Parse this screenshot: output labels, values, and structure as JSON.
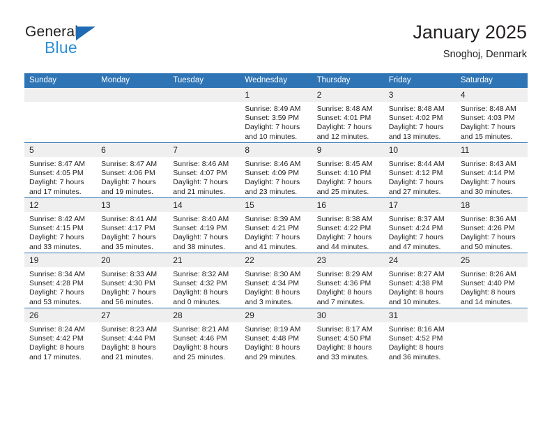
{
  "brand": {
    "name_top": "General",
    "name_bottom": "Blue",
    "triangle_color": "#1f6cb4",
    "blue_color": "#2d8fd5"
  },
  "header": {
    "title": "January 2025",
    "subtitle": "Snoghoj, Denmark"
  },
  "theme": {
    "header_bg": "#2f75b5",
    "header_text": "#ffffff",
    "daynum_bg": "#efefef",
    "grid_line": "#2f75b5",
    "text": "#231f20"
  },
  "labels": {
    "sunrise": "Sunrise:",
    "sunset": "Sunset:",
    "daylight": "Daylight:"
  },
  "weekdays": [
    "Sunday",
    "Monday",
    "Tuesday",
    "Wednesday",
    "Thursday",
    "Friday",
    "Saturday"
  ],
  "weeks": [
    [
      {
        "day": "",
        "empty": true
      },
      {
        "day": "",
        "empty": true
      },
      {
        "day": "",
        "empty": true
      },
      {
        "day": "1",
        "sunrise": "Sunrise: 8:49 AM",
        "sunset": "Sunset: 3:59 PM",
        "daylight_1": "Daylight: 7 hours",
        "daylight_2": "and 10 minutes."
      },
      {
        "day": "2",
        "sunrise": "Sunrise: 8:48 AM",
        "sunset": "Sunset: 4:01 PM",
        "daylight_1": "Daylight: 7 hours",
        "daylight_2": "and 12 minutes."
      },
      {
        "day": "3",
        "sunrise": "Sunrise: 8:48 AM",
        "sunset": "Sunset: 4:02 PM",
        "daylight_1": "Daylight: 7 hours",
        "daylight_2": "and 13 minutes."
      },
      {
        "day": "4",
        "sunrise": "Sunrise: 8:48 AM",
        "sunset": "Sunset: 4:03 PM",
        "daylight_1": "Daylight: 7 hours",
        "daylight_2": "and 15 minutes."
      }
    ],
    [
      {
        "day": "5",
        "sunrise": "Sunrise: 8:47 AM",
        "sunset": "Sunset: 4:05 PM",
        "daylight_1": "Daylight: 7 hours",
        "daylight_2": "and 17 minutes."
      },
      {
        "day": "6",
        "sunrise": "Sunrise: 8:47 AM",
        "sunset": "Sunset: 4:06 PM",
        "daylight_1": "Daylight: 7 hours",
        "daylight_2": "and 19 minutes."
      },
      {
        "day": "7",
        "sunrise": "Sunrise: 8:46 AM",
        "sunset": "Sunset: 4:07 PM",
        "daylight_1": "Daylight: 7 hours",
        "daylight_2": "and 21 minutes."
      },
      {
        "day": "8",
        "sunrise": "Sunrise: 8:46 AM",
        "sunset": "Sunset: 4:09 PM",
        "daylight_1": "Daylight: 7 hours",
        "daylight_2": "and 23 minutes."
      },
      {
        "day": "9",
        "sunrise": "Sunrise: 8:45 AM",
        "sunset": "Sunset: 4:10 PM",
        "daylight_1": "Daylight: 7 hours",
        "daylight_2": "and 25 minutes."
      },
      {
        "day": "10",
        "sunrise": "Sunrise: 8:44 AM",
        "sunset": "Sunset: 4:12 PM",
        "daylight_1": "Daylight: 7 hours",
        "daylight_2": "and 27 minutes."
      },
      {
        "day": "11",
        "sunrise": "Sunrise: 8:43 AM",
        "sunset": "Sunset: 4:14 PM",
        "daylight_1": "Daylight: 7 hours",
        "daylight_2": "and 30 minutes."
      }
    ],
    [
      {
        "day": "12",
        "sunrise": "Sunrise: 8:42 AM",
        "sunset": "Sunset: 4:15 PM",
        "daylight_1": "Daylight: 7 hours",
        "daylight_2": "and 33 minutes."
      },
      {
        "day": "13",
        "sunrise": "Sunrise: 8:41 AM",
        "sunset": "Sunset: 4:17 PM",
        "daylight_1": "Daylight: 7 hours",
        "daylight_2": "and 35 minutes."
      },
      {
        "day": "14",
        "sunrise": "Sunrise: 8:40 AM",
        "sunset": "Sunset: 4:19 PM",
        "daylight_1": "Daylight: 7 hours",
        "daylight_2": "and 38 minutes."
      },
      {
        "day": "15",
        "sunrise": "Sunrise: 8:39 AM",
        "sunset": "Sunset: 4:21 PM",
        "daylight_1": "Daylight: 7 hours",
        "daylight_2": "and 41 minutes."
      },
      {
        "day": "16",
        "sunrise": "Sunrise: 8:38 AM",
        "sunset": "Sunset: 4:22 PM",
        "daylight_1": "Daylight: 7 hours",
        "daylight_2": "and 44 minutes."
      },
      {
        "day": "17",
        "sunrise": "Sunrise: 8:37 AM",
        "sunset": "Sunset: 4:24 PM",
        "daylight_1": "Daylight: 7 hours",
        "daylight_2": "and 47 minutes."
      },
      {
        "day": "18",
        "sunrise": "Sunrise: 8:36 AM",
        "sunset": "Sunset: 4:26 PM",
        "daylight_1": "Daylight: 7 hours",
        "daylight_2": "and 50 minutes."
      }
    ],
    [
      {
        "day": "19",
        "sunrise": "Sunrise: 8:34 AM",
        "sunset": "Sunset: 4:28 PM",
        "daylight_1": "Daylight: 7 hours",
        "daylight_2": "and 53 minutes."
      },
      {
        "day": "20",
        "sunrise": "Sunrise: 8:33 AM",
        "sunset": "Sunset: 4:30 PM",
        "daylight_1": "Daylight: 7 hours",
        "daylight_2": "and 56 minutes."
      },
      {
        "day": "21",
        "sunrise": "Sunrise: 8:32 AM",
        "sunset": "Sunset: 4:32 PM",
        "daylight_1": "Daylight: 8 hours",
        "daylight_2": "and 0 minutes."
      },
      {
        "day": "22",
        "sunrise": "Sunrise: 8:30 AM",
        "sunset": "Sunset: 4:34 PM",
        "daylight_1": "Daylight: 8 hours",
        "daylight_2": "and 3 minutes."
      },
      {
        "day": "23",
        "sunrise": "Sunrise: 8:29 AM",
        "sunset": "Sunset: 4:36 PM",
        "daylight_1": "Daylight: 8 hours",
        "daylight_2": "and 7 minutes."
      },
      {
        "day": "24",
        "sunrise": "Sunrise: 8:27 AM",
        "sunset": "Sunset: 4:38 PM",
        "daylight_1": "Daylight: 8 hours",
        "daylight_2": "and 10 minutes."
      },
      {
        "day": "25",
        "sunrise": "Sunrise: 8:26 AM",
        "sunset": "Sunset: 4:40 PM",
        "daylight_1": "Daylight: 8 hours",
        "daylight_2": "and 14 minutes."
      }
    ],
    [
      {
        "day": "26",
        "sunrise": "Sunrise: 8:24 AM",
        "sunset": "Sunset: 4:42 PM",
        "daylight_1": "Daylight: 8 hours",
        "daylight_2": "and 17 minutes."
      },
      {
        "day": "27",
        "sunrise": "Sunrise: 8:23 AM",
        "sunset": "Sunset: 4:44 PM",
        "daylight_1": "Daylight: 8 hours",
        "daylight_2": "and 21 minutes."
      },
      {
        "day": "28",
        "sunrise": "Sunrise: 8:21 AM",
        "sunset": "Sunset: 4:46 PM",
        "daylight_1": "Daylight: 8 hours",
        "daylight_2": "and 25 minutes."
      },
      {
        "day": "29",
        "sunrise": "Sunrise: 8:19 AM",
        "sunset": "Sunset: 4:48 PM",
        "daylight_1": "Daylight: 8 hours",
        "daylight_2": "and 29 minutes."
      },
      {
        "day": "30",
        "sunrise": "Sunrise: 8:17 AM",
        "sunset": "Sunset: 4:50 PM",
        "daylight_1": "Daylight: 8 hours",
        "daylight_2": "and 33 minutes."
      },
      {
        "day": "31",
        "sunrise": "Sunrise: 8:16 AM",
        "sunset": "Sunset: 4:52 PM",
        "daylight_1": "Daylight: 8 hours",
        "daylight_2": "and 36 minutes."
      },
      {
        "day": "",
        "empty": true
      }
    ]
  ]
}
